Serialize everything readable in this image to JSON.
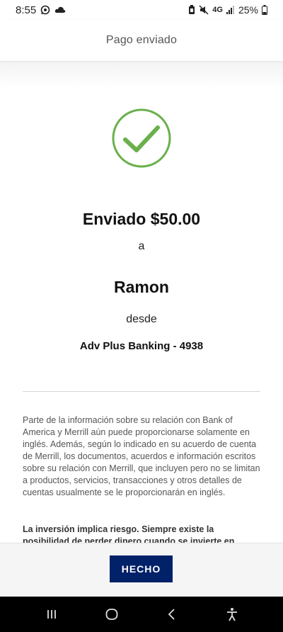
{
  "status_bar": {
    "time": "8:55",
    "network": "4G",
    "battery": "25%",
    "icons": [
      "whatsapp-icon",
      "cloud-icon",
      "battery-saver-icon",
      "mute-icon",
      "signal-icon",
      "battery-icon"
    ]
  },
  "header": {
    "title": "Pago enviado"
  },
  "confirmation": {
    "check_color": "#6ab04c",
    "sent_amount": "Enviado $50.00",
    "to_label": "a",
    "recipient": "Ramon",
    "from_label": "desde",
    "account": "Adv Plus Banking - 4938"
  },
  "disclaimer": {
    "text": "Parte de la información sobre su relación con Bank of America y Merrill aún puede proporcionarse solamente en inglés. Además, según lo indicado en su acuerdo de cuenta de Merrill, los documentos, acuerdos e información escritos sobre su relación con Merrill, que incluyen pero no se limitan a productos, servicios, transacciones y otros detalles de cuentas usualmente se le proporcionarán en inglés.",
    "risk": "La inversión implica riesgo. Siempre existe la posibilidad de perder dinero cuando se invierte en"
  },
  "footer": {
    "done_label": "HECHO",
    "button_color": "#012169"
  },
  "nav_bar": {
    "icons": [
      "recents-icon",
      "home-icon",
      "back-icon",
      "accessibility-icon"
    ]
  }
}
